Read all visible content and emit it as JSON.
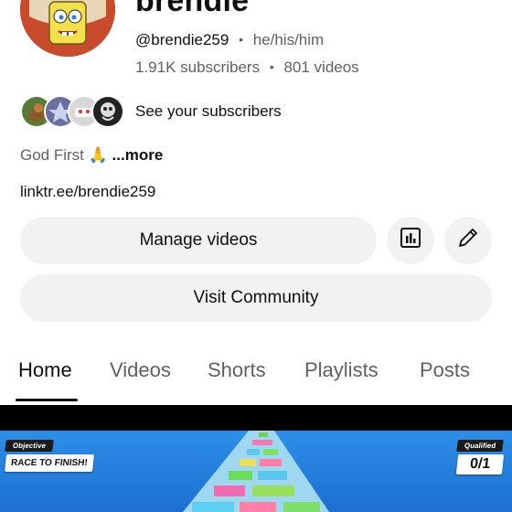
{
  "channel": {
    "name": "brendie",
    "handle": "@brendie259",
    "pronouns": "he/his/him",
    "subscribers": "1.91K subscribers",
    "videos": "801 videos",
    "separator": "•"
  },
  "subscribers_preview": {
    "label": "See your subscribers"
  },
  "bio": {
    "text": "God First 🙏",
    "more": "...more"
  },
  "link": {
    "text": "linktr.ee/brendie259"
  },
  "buttons": {
    "manage_videos": "Manage videos",
    "visit_community": "Visit Community",
    "stats_icon": "bar-chart-icon",
    "edit_icon": "pencil-icon"
  },
  "tabs": [
    {
      "label": "Home",
      "active": true
    },
    {
      "label": "Videos",
      "active": false
    },
    {
      "label": "Shorts",
      "active": false
    },
    {
      "label": "Playlists",
      "active": false
    },
    {
      "label": "Posts",
      "active": false
    }
  ],
  "video": {
    "objective_tag": "Objective",
    "objective_text": "RACE TO FINISH!",
    "qualified_tag": "Qualified",
    "qualified_value": "0/1"
  },
  "colors": {
    "button_bg": "#f2f2f2",
    "text_primary": "#0f0f0f",
    "text_secondary": "#606060",
    "game_sky": "#2d8fe8"
  }
}
